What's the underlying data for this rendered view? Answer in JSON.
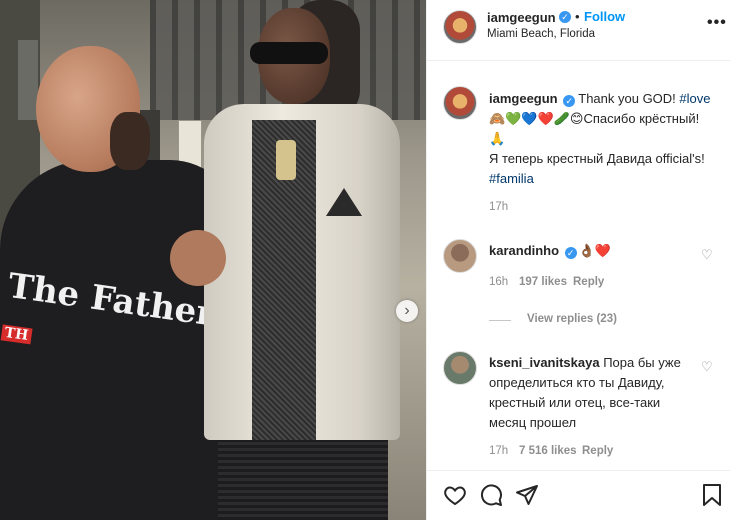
{
  "post": {
    "username": "iamgeegun",
    "follow_label": "Follow",
    "location": "Miami Beach, Florida",
    "more_label": "•••",
    "photo_print": "The Father",
    "photo_print_sub": "TH"
  },
  "caption": {
    "username": "iamgeegun",
    "text1": "Thank you GOD! ",
    "tag1": "#love",
    "line2_emoji": "🙈💚💙❤️🥒😊",
    "line2_text": "Спасибо крёстный!",
    "line3_emoji": "🙏",
    "line4_text": "Я теперь крестный Давида official's!",
    "tag2": "#familia",
    "time": "17h"
  },
  "comments": [
    {
      "username": "karandinho",
      "emoji": "👌🏾❤️",
      "time": "16h",
      "likes": "197 likes",
      "reply": "Reply",
      "view_replies": "View replies (23)"
    },
    {
      "username": "kseni_ivanitskaya",
      "lines": [
        "Пора бы уже",
        "определиться кто ты Давиду,",
        "крестный или отец, все-таки",
        "месяц прошел"
      ],
      "time": "17h",
      "likes": "7 516 likes",
      "reply": "Reply"
    }
  ],
  "colors": {
    "accent": "#0095f6",
    "verified": "#3897f0",
    "muted": "#8e8e8e",
    "tag": "#00376b"
  },
  "icons": [
    "heart-icon",
    "comment-icon",
    "share-icon",
    "bookmark-icon",
    "chevron-right-icon",
    "verified-icon",
    "more-icon"
  ]
}
